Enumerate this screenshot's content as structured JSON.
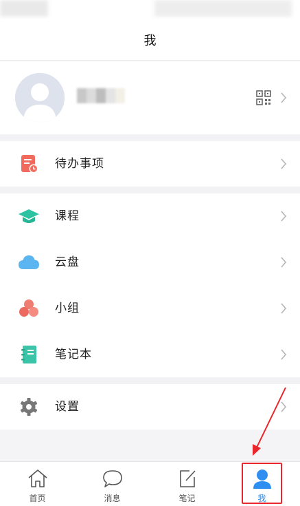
{
  "nav": {
    "title": "我"
  },
  "menu": {
    "todo": "待办事项",
    "items": [
      "课程",
      "云盘",
      "小组",
      "笔记本"
    ],
    "settings": "设置"
  },
  "tabs": [
    {
      "label": "首页",
      "icon": "home-icon"
    },
    {
      "label": "消息",
      "icon": "message-icon"
    },
    {
      "label": "笔记",
      "icon": "note-icon"
    },
    {
      "label": "我",
      "icon": "person-icon",
      "active": true
    }
  ],
  "colors": {
    "accent": "#2e8ff0",
    "todo_icon": "#f06b5d",
    "course_icon": "#2dc3a2",
    "cloud_icon": "#5bb5f0",
    "group_icon": "#f07d72",
    "notebook_icon": "#3cc4a8",
    "settings_icon": "#777777",
    "highlight": "#e8262b"
  }
}
